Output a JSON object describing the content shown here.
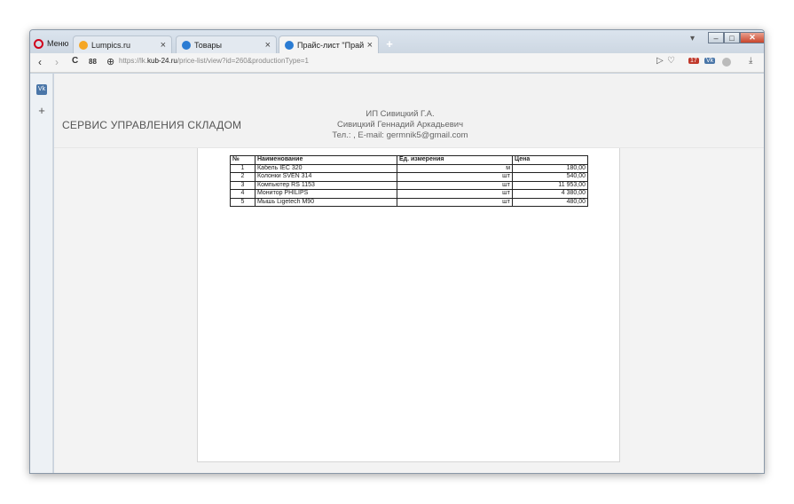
{
  "browser": {
    "menu_label": "Меню",
    "tabs": [
      {
        "title": "Lumpics.ru",
        "close": "×",
        "color": "#f5a623"
      },
      {
        "title": "Товары",
        "close": "×",
        "color": "#2b7cd3"
      },
      {
        "title": "Прайс-лист \"Прайс-лист\"",
        "close": "×",
        "color": "#2b7cd3"
      }
    ],
    "new_tab": "+",
    "url_prefix": "https://lk.",
    "url_domain": "kub-24.ru",
    "url_path": "/price-list/view?id=260&productionType=1",
    "sync_badge": "17",
    "window_buttons": {
      "minimize": "–",
      "maximize": "□",
      "close": "✕"
    }
  },
  "nav": {
    "back": "‹",
    "forward": "›",
    "reload": "C",
    "grid": "88",
    "globe": "⊕",
    "flow": "▷",
    "heart": "♡",
    "download": "⤓"
  },
  "sidebar": {
    "add": "+",
    "vk": "Vk"
  },
  "site": {
    "title": "СЕРВИС УПРАВЛЕНИЯ СКЛАДОМ",
    "owner_short": "ИП Сивицкий Г.А.",
    "owner_full": "Сивицкий Геннадий Аркадьевич",
    "contact": "Тел.: , E-mail: germnik5@gmail.com"
  },
  "price_table": {
    "headers": [
      "№",
      "Наименование",
      "Ед. измерения",
      "Цена"
    ],
    "rows": [
      {
        "n": "1",
        "name": "Кабель IEC 320",
        "unit": "м",
        "price": "180,00"
      },
      {
        "n": "2",
        "name": "Колонки SVEN 314",
        "unit": "шт",
        "price": "540,00"
      },
      {
        "n": "3",
        "name": "Компьютер RS 1153",
        "unit": "шт",
        "price": "11 953,00"
      },
      {
        "n": "4",
        "name": "Монитор PHILIPS",
        "unit": "шт",
        "price": "4 380,00"
      },
      {
        "n": "5",
        "name": "Мышь Ligetech M90",
        "unit": "шт",
        "price": "480,00"
      }
    ]
  }
}
